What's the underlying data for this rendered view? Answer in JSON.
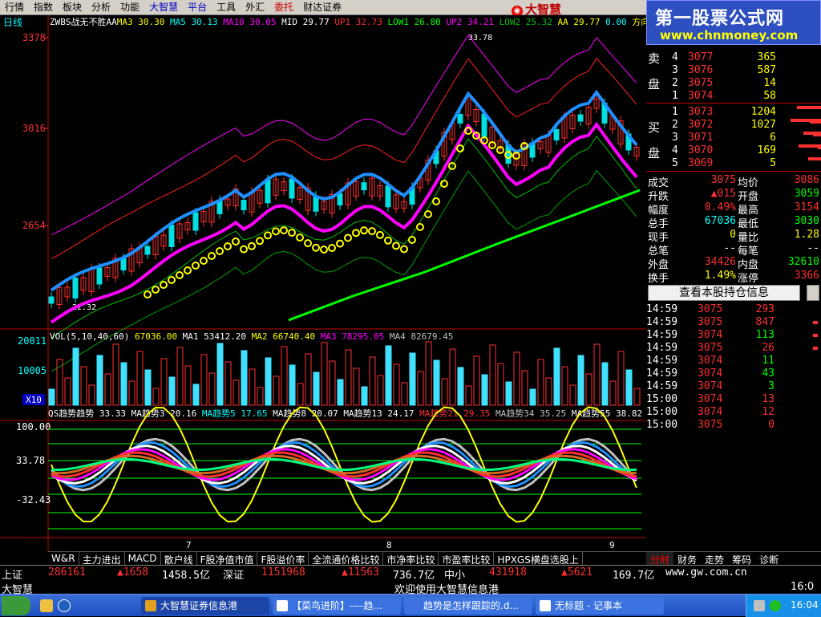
{
  "menu": [
    "行情",
    "指数",
    "板块",
    "分析",
    "功能",
    "大智慧",
    "平台",
    "工具",
    "外汇",
    "委托",
    "财达证券"
  ],
  "menu_colors": [
    "#000000",
    "#000000",
    "#000000",
    "#000000",
    "#000000",
    "#0000c8",
    "#0000c8",
    "#000000",
    "#000000",
    "#c80000",
    "#000000"
  ],
  "logo_text": "大智慧",
  "watermark": {
    "title": "第一股票公式网",
    "url": "www.chnmoney.com"
  },
  "period_label": "日线",
  "main_indicator": {
    "name": "ZWBS战无不胜AA",
    "items": [
      {
        "label": "MA3",
        "value": "30.30",
        "color": "#ffff00"
      },
      {
        "label": "MA5",
        "value": "30.13",
        "color": "#00ffff"
      },
      {
        "label": "MA10",
        "value": "30.05",
        "color": "#ff00ff"
      },
      {
        "label": "MID",
        "value": "29.77",
        "color": "#ffffff"
      },
      {
        "label": "UP1",
        "value": "32.73",
        "color": "#ff3030"
      },
      {
        "label": "LOW1",
        "value": "26.80",
        "color": "#00ff00"
      },
      {
        "label": "UP2",
        "value": "34.21",
        "color": "#ff00ff"
      },
      {
        "label": "LOW2",
        "value": "25.32",
        "color": "#00c000"
      },
      {
        "label": "AA",
        "value": "29.77",
        "color": "#ffff00"
      },
      {
        "label": "",
        "value": "0.00",
        "color": "#00ffff"
      },
      {
        "label": "方向线",
        "value": "",
        "color": "#ffff00"
      }
    ]
  },
  "price_axis": [
    "3378",
    "3016",
    "2654"
  ],
  "price_annotations": [
    "33.78",
    "22.32"
  ],
  "volume": {
    "header": "VOL(5,10,40,60)",
    "items": [
      {
        "label": "",
        "value": "67036.00",
        "color": "#ffff00"
      },
      {
        "label": "MA1",
        "value": "53412.20",
        "color": "#ffffff"
      },
      {
        "label": "MA2",
        "value": "66740.40",
        "color": "#ffff00"
      },
      {
        "label": "MA3",
        "value": "78295.05",
        "color": "#ff00ff"
      },
      {
        "label": "MA4",
        "value": "82679.45",
        "color": "#c0c0c0"
      }
    ],
    "axis": [
      "20011",
      "10005"
    ],
    "unit": "X10"
  },
  "qs": {
    "items": [
      {
        "label": "QS趋势趋势",
        "value": "33.33",
        "color": "#ffffff"
      },
      {
        "label": "MA趋势3",
        "value": "20.16",
        "color": "#ffffff"
      },
      {
        "label": "MA趋势5",
        "value": "17.65",
        "color": "#00ffff"
      },
      {
        "label": "MA趋势8",
        "value": "20.07",
        "color": "#ffffff"
      },
      {
        "label": "MA趋势13",
        "value": "24.17",
        "color": "#ffffff"
      },
      {
        "label": "MA趋势21",
        "value": "29.35",
        "color": "#ff3030"
      },
      {
        "label": "MA趋势34",
        "value": "35.25",
        "color": "#c0c0c0"
      },
      {
        "label": "MA趋势55",
        "value": "38.82",
        "color": "#ffffff"
      },
      {
        "label": "MA趋势",
        "value": "",
        "color": "#00ff00"
      }
    ],
    "axis": [
      "100.00",
      "33.78",
      "-32.43"
    ]
  },
  "x_ticks": [
    "7",
    "8",
    "9"
  ],
  "order_book": {
    "sell_label": [
      "卖",
      "盘"
    ],
    "buy_label": [
      "买",
      "盘"
    ],
    "sell": [
      {
        "lvl": "4",
        "price": "3077",
        "vol": "365"
      },
      {
        "lvl": "3",
        "price": "3076",
        "vol": "587"
      },
      {
        "lvl": "2",
        "price": "3075",
        "vol": "14"
      },
      {
        "lvl": "1",
        "price": "3074",
        "vol": "58"
      }
    ],
    "buy": [
      {
        "lvl": "1",
        "price": "3073",
        "vol": "1204"
      },
      {
        "lvl": "2",
        "price": "3072",
        "vol": "1027"
      },
      {
        "lvl": "3",
        "price": "3071",
        "vol": "6"
      },
      {
        "lvl": "4",
        "price": "3070",
        "vol": "169"
      },
      {
        "lvl": "5",
        "price": "3069",
        "vol": "5"
      }
    ]
  },
  "stats": [
    {
      "l1": "成交",
      "v1": "3075",
      "c1": "#ff3030",
      "l2": "均价",
      "v2": "3086",
      "c2": "#ff3030"
    },
    {
      "l1": "升跌",
      "v1": "▲015",
      "c1": "#ff3030",
      "l2": "开盘",
      "v2": "3059",
      "c2": "#00ff00"
    },
    {
      "l1": "幅度",
      "v1": "0.49%",
      "c1": "#ff3030",
      "l2": "最高",
      "v2": "3154",
      "c2": "#ff3030"
    },
    {
      "l1": "总手",
      "v1": "67036",
      "c1": "#00ffff",
      "l2": "最低",
      "v2": "3030",
      "c2": "#00ff00"
    },
    {
      "l1": "现手",
      "v1": "0",
      "c1": "#ffff00",
      "l2": "量比",
      "v2": "1.28",
      "c2": "#ffff00"
    },
    {
      "l1": "总笔",
      "v1": "--",
      "c1": "#ffffff",
      "l2": "每笔",
      "v2": "--",
      "c2": "#ffffff"
    },
    {
      "l1": "外盘",
      "v1": "34426",
      "c1": "#ff3030",
      "l2": "内盘",
      "v2": "32610",
      "c2": "#00ff00"
    },
    {
      "l1": "换手",
      "v1": "1.49%",
      "c1": "#ffff00",
      "l2": "涨停",
      "v2": "3366",
      "c2": "#ff3030"
    }
  ],
  "holdings_button": "查看本股持仓信息",
  "ticks": [
    {
      "t": "14:59",
      "p": "3075",
      "v": "293",
      "pc": "#ff3030",
      "vc": "#ff3030"
    },
    {
      "t": "14:59",
      "p": "3075",
      "v": "847",
      "pc": "#ff3030",
      "vc": "#ff3030"
    },
    {
      "t": "14:59",
      "p": "3074",
      "v": "113",
      "pc": "#ff3030",
      "vc": "#00ff00"
    },
    {
      "t": "14:59",
      "p": "3075",
      "v": "26",
      "pc": "#ff3030",
      "vc": "#ff3030"
    },
    {
      "t": "14:59",
      "p": "3074",
      "v": "11",
      "pc": "#ff3030",
      "vc": "#00ff00"
    },
    {
      "t": "14:59",
      "p": "3074",
      "v": "43",
      "pc": "#ff3030",
      "vc": "#00ff00"
    },
    {
      "t": "14:59",
      "p": "3074",
      "v": "3",
      "pc": "#ff3030",
      "vc": "#00ff00"
    },
    {
      "t": "15:00",
      "p": "3074",
      "v": "13",
      "pc": "#ff3030",
      "vc": "#ff3030"
    },
    {
      "t": "15:00",
      "p": "3074",
      "v": "12",
      "pc": "#ff3030",
      "vc": "#ff3030"
    },
    {
      "t": "15:00",
      "p": "3075",
      "v": "0",
      "pc": "#ff3030",
      "vc": "#ff3030"
    }
  ],
  "bottom_tabs": [
    "W&R",
    "主力进出",
    "MACD",
    "散户线",
    "F股净值市值",
    "F股溢价率",
    "全流通价格比较",
    "市净率比较",
    "市盈率比较",
    "HPXGS横盘选股上"
  ],
  "right_tabs": [
    "分时",
    "财务",
    "走势",
    "筹码",
    "诊断"
  ],
  "status1": {
    "sh_label": "上证",
    "sh_index": "286161",
    "sh_change": "▲1658",
    "sh_amount": "1458.5亿",
    "sz_label": "深证",
    "sz_index": "1151968",
    "sz_change": "▲11563",
    "sz_amount": "736.7亿",
    "zx_label": "中小",
    "zx_index": "431918",
    "zx_change": "▲5621",
    "zx_amount": "169.7亿",
    "site": "www.gw.com.cn"
  },
  "status2": {
    "brand": "大智慧",
    "welcome": "欢迎使用大智慧信息港",
    "time": "16:0"
  },
  "taskbar": {
    "items": [
      "大智慧证券信息港",
      "【菜鸟进阶】----趋...",
      "趋势是怎样跟踪的.d...",
      "无标题 - 记事本"
    ],
    "clock": "16:04"
  }
}
